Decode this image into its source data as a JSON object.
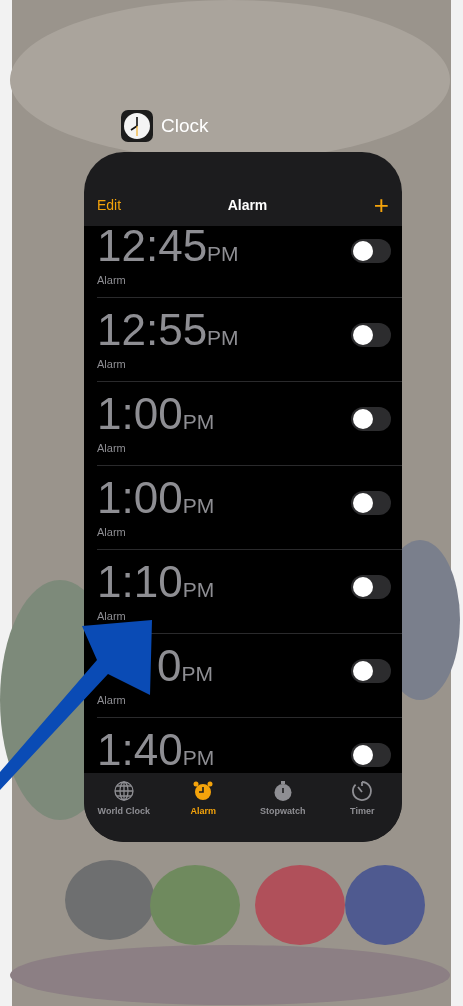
{
  "app_label": "Clock",
  "nav": {
    "left": "Edit",
    "title": "Alarm",
    "right": "+"
  },
  "alarms": [
    {
      "time": "12:45",
      "period": "PM",
      "label": "Alarm",
      "on": false
    },
    {
      "time": "12:55",
      "period": "PM",
      "label": "Alarm",
      "on": false
    },
    {
      "time": "1:00",
      "period": "PM",
      "label": "Alarm",
      "on": false
    },
    {
      "time": "1:00",
      "period": "PM",
      "label": "Alarm",
      "on": false
    },
    {
      "time": "1:10",
      "period": "PM",
      "label": "Alarm",
      "on": false
    },
    {
      "time": "0",
      "period": "PM",
      "label": "Alarm",
      "on": false,
      "covered": true
    },
    {
      "time": "1:40",
      "period": "PM",
      "on": false
    }
  ],
  "tabs": [
    {
      "kind": "globe",
      "label": "World Clock",
      "selected": false
    },
    {
      "kind": "alarm",
      "label": "Alarm",
      "selected": true
    },
    {
      "kind": "stopwatch",
      "label": "Stopwatch",
      "selected": false
    },
    {
      "kind": "timer",
      "label": "Timer",
      "selected": false
    }
  ]
}
